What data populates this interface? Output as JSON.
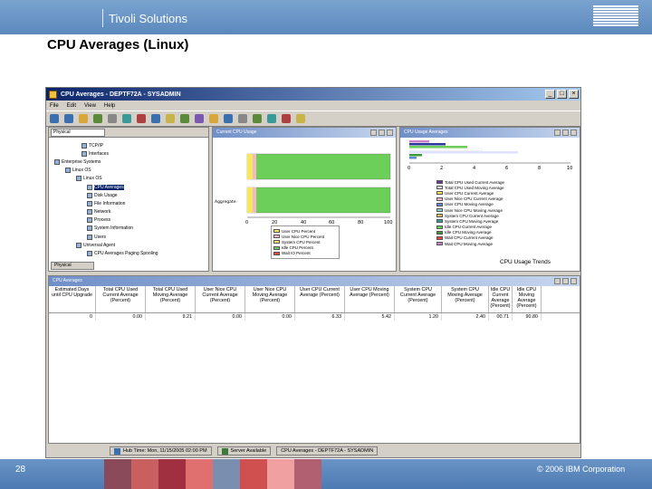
{
  "header": {
    "section": "Tivoli Solutions",
    "logo": "IBM"
  },
  "slide": {
    "title": "CPU Averages (Linux)"
  },
  "window": {
    "title": "CPU Averages - DEPTF72A - SYSADMIN",
    "menu": [
      "File",
      "Edit",
      "View",
      "Help"
    ]
  },
  "navigator": {
    "view": "Physical",
    "tab": "Physical",
    "items": [
      "TCP/IP",
      "Interfaces",
      "Enterprise Systems",
      "Linux OS",
      "Linux OS",
      "CPU Averages",
      "Disk Usage",
      "File Information",
      "Network",
      "Process",
      "System Information",
      "Users",
      "Universal Agent",
      "CPU Averages Paging Spooling"
    ]
  },
  "bar_panel": {
    "title": "Current CPU Usage",
    "category_label": "Aggregate",
    "x_ticks": [
      "0",
      "20",
      "40",
      "60",
      "80",
      "100"
    ],
    "legend": [
      "User CPU Percent",
      "User Nice CPU Percent",
      "System CPU Percent",
      "Idle CPU Percent",
      "Wait IO Percent"
    ]
  },
  "trend_panel": {
    "title": "CPU Usage Averages",
    "footer": "CPU Usage Trends",
    "x_ticks": [
      "0",
      "2",
      "4",
      "6",
      "8",
      "10"
    ],
    "legend": [
      "Total CPU Used Current Average",
      "Total CPU Used Moving Average",
      "User CPU Current Average",
      "User Nice CPU Current Average",
      "User CPU Moving Average",
      "User Nice CPU Moving Average",
      "System CPU Current Average",
      "System CPU Moving Average",
      "Idle CPU Current Average",
      "Idle CPU Moving Average",
      "Wait CPU Current Average",
      "Wait CPU Moving Average"
    ]
  },
  "table": {
    "title": "CPU Averages",
    "columns": [
      "Estimated Days until CPU Upgrade",
      "Total CPU Used Current Average (Percent)",
      "Total CPU Used Moving Average (Percent)",
      "User Nice CPU Current Average (Percent)",
      "User Nice CPU Moving Average (Percent)",
      "User CPU Current Average (Percent)",
      "User CPU Moving Average (Percent)",
      "System CPU Current Average (Percent)",
      "System CPU Moving Average (Percent)",
      "Idle CPU Current Average (Percent)",
      "Idle CPU Moving Average (Percent)"
    ],
    "rows": [
      [
        "0",
        "0.00",
        "9.21",
        "0.00",
        "0.00",
        "6.33",
        "5.42",
        "1.20",
        "2.40",
        "00.71",
        "90.80"
      ]
    ]
  },
  "status_bar": {
    "time": "Hub Time: Mon, 11/15/2005 02:00 PM",
    "server": "Server Available",
    "workspace": "CPU Averages - DEPTF72A - SYSADMIN"
  },
  "footer": {
    "page": "28",
    "copyright": "© 2006 IBM Corporation"
  },
  "colors": {
    "header_band": "#6a94c6",
    "user_cpu": "#f5e85a",
    "user_nice_cpu": "#f5b8c8",
    "system_cpu": "#f5e85a",
    "idle_cpu": "#6ccf5a",
    "wait_io": "#e84a3a"
  }
}
